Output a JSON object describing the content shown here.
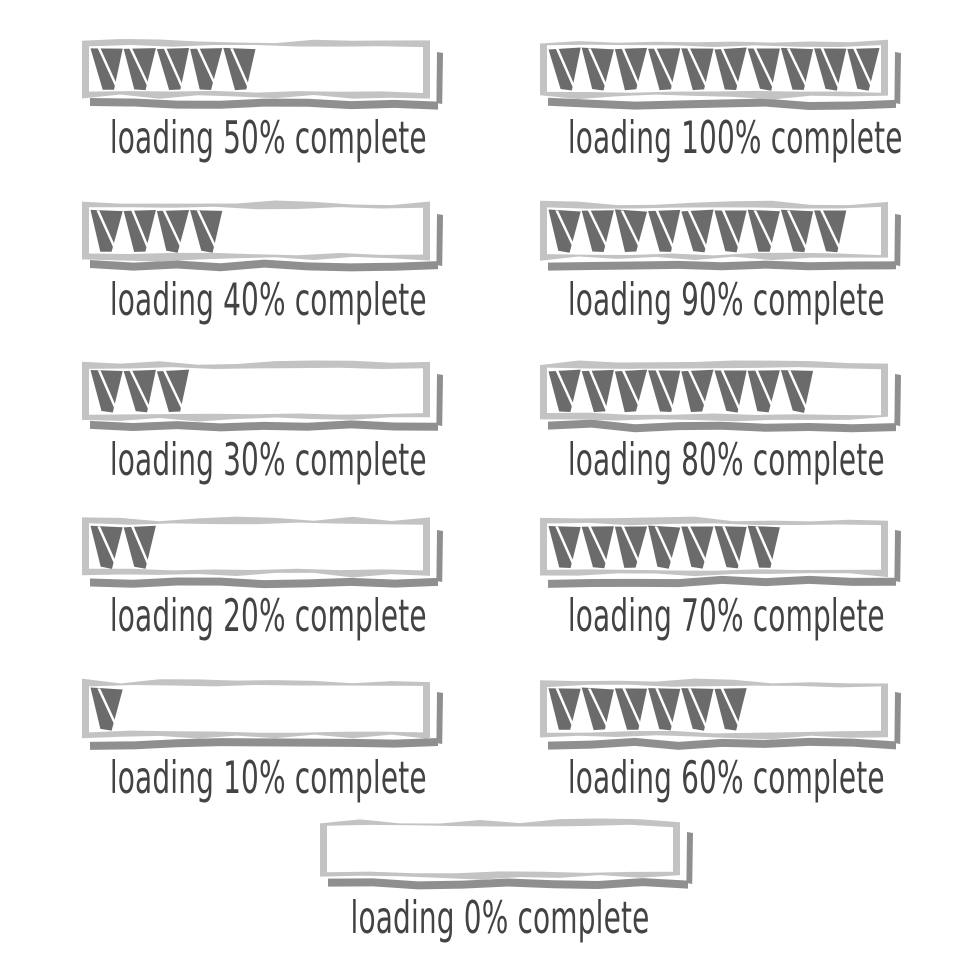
{
  "page": {
    "title": "Hand-drawn loading progress bars",
    "background_color": "#ffffff",
    "fill_color": "#6b6b6b",
    "frame_color": "#c3c3c3",
    "shadow_color": "#8f8f8f",
    "text_color": "#434343",
    "label_template": "loading {value}% complete"
  },
  "bars": [
    {
      "id": "bar-50",
      "label": "loading 50% complete",
      "percent": 50,
      "segments": 5,
      "column": "left",
      "row": 1
    },
    {
      "id": "bar-100",
      "label": "loading 100% complete",
      "percent": 100,
      "segments": 10,
      "column": "right",
      "row": 1
    },
    {
      "id": "bar-40",
      "label": "loading 40% complete",
      "percent": 40,
      "segments": 4,
      "column": "left",
      "row": 2
    },
    {
      "id": "bar-90",
      "label": "loading 90% complete",
      "percent": 90,
      "segments": 9,
      "column": "right",
      "row": 2
    },
    {
      "id": "bar-30",
      "label": "loading 30% complete",
      "percent": 30,
      "segments": 3,
      "column": "left",
      "row": 3
    },
    {
      "id": "bar-80",
      "label": "loading 80% complete",
      "percent": 80,
      "segments": 8,
      "column": "right",
      "row": 3
    },
    {
      "id": "bar-20",
      "label": "loading 20% complete",
      "percent": 20,
      "segments": 2,
      "column": "left",
      "row": 4
    },
    {
      "id": "bar-70",
      "label": "loading 70% complete",
      "percent": 70,
      "segments": 7,
      "column": "right",
      "row": 4
    },
    {
      "id": "bar-10",
      "label": "loading 10% complete",
      "percent": 10,
      "segments": 1,
      "column": "left",
      "row": 5
    },
    {
      "id": "bar-60",
      "label": "loading 60% complete",
      "percent": 60,
      "segments": 6,
      "column": "right",
      "row": 5
    },
    {
      "id": "bar-0",
      "label": "loading 0% complete",
      "percent": 0,
      "segments": 0,
      "column": "center",
      "row": 6
    }
  ]
}
